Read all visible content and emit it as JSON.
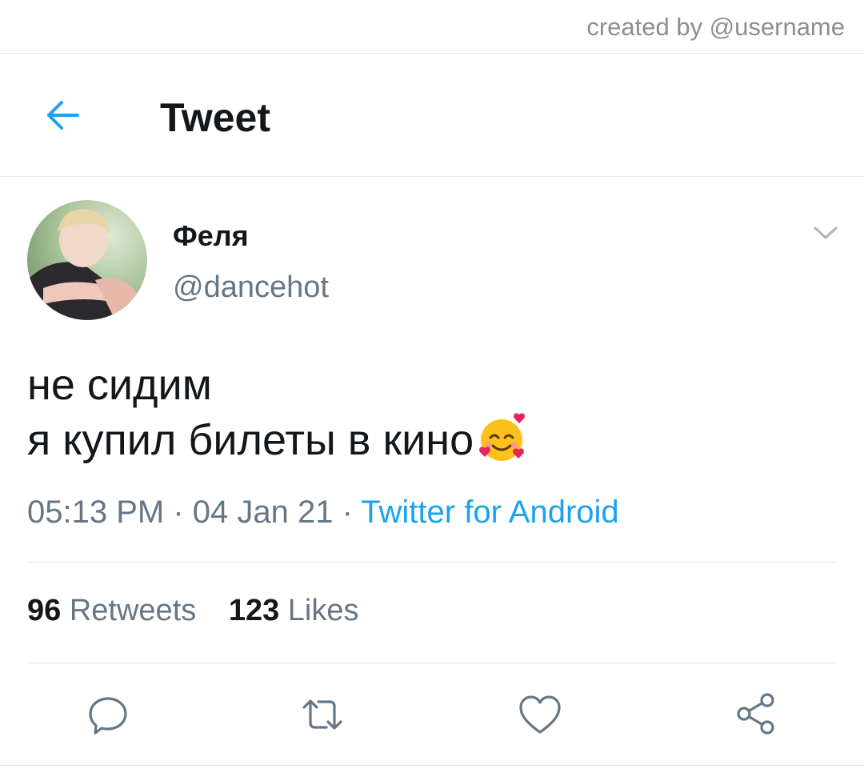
{
  "credit": "created by @username",
  "header": {
    "title": "Tweet",
    "back_icon": "arrow-left-icon",
    "accent_color": "#1da1f2"
  },
  "tweet": {
    "display_name": "Феля",
    "handle": "@dancehot",
    "text_lines": [
      "не сидим",
      "я купил билеты в кино"
    ],
    "emoji": "smiling-face-with-hearts",
    "time": "05:13 PM",
    "separator": " · ",
    "date": "04 Jan 21",
    "source": "Twitter for Android"
  },
  "stats": {
    "retweets_count": "96",
    "retweets_label": "Retweets",
    "likes_count": "123",
    "likes_label": "Likes"
  },
  "actions": [
    "reply-icon",
    "retweet-icon",
    "like-icon",
    "share-icon"
  ],
  "colors": {
    "text": "#14171a",
    "secondary": "#657786",
    "link": "#1da1f2",
    "divider": "#e1e5e9"
  }
}
